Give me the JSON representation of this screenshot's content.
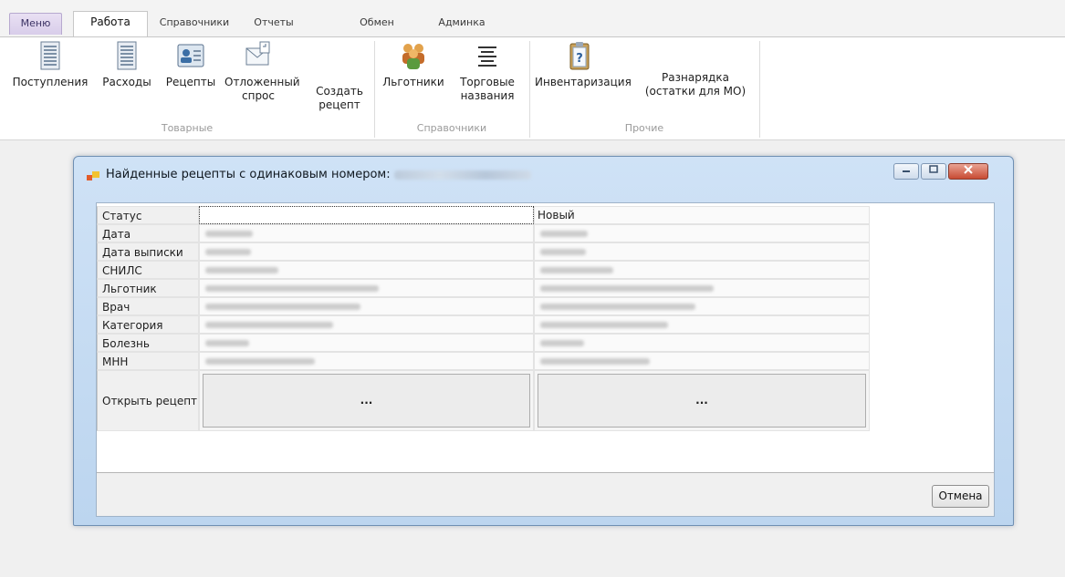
{
  "tabs": {
    "menu": "Меню",
    "work": "Работа",
    "directories": "Справочники",
    "reports": "Отчеты",
    "exchange": "Обмен",
    "admin": "Админка"
  },
  "ribbon": {
    "buttons": {
      "receipts": "Поступления",
      "expenses": "Расходы",
      "recipes": "Рецепты",
      "deferred_line1": "Отложенный",
      "deferred_line2": "спрос",
      "create_line1": "Создать",
      "create_line2": "рецепт",
      "beneficiaries": "Льготники",
      "trade_line1": "Торговые",
      "trade_line2": "названия",
      "inventory": "Инвентаризация",
      "allocation_line1": "Разнарядка",
      "allocation_line2": "(остатки для МО)"
    },
    "groups": {
      "goods": "Товарные",
      "directories": "Справочники",
      "other": "Прочие"
    }
  },
  "dialog": {
    "title": "Найденные рецепты с одинаковым номером:",
    "rows": {
      "status": "Статус",
      "date": "Дата",
      "issue_date": "Дата выписки",
      "snils": "СНИЛС",
      "beneficiary": "Льготник",
      "doctor": "Врач",
      "category": "Категория",
      "disease": "Болезнь",
      "inn": "МНН",
      "open": "Открыть рецепт"
    },
    "status_col2": "Новый",
    "open_button": "...",
    "cancel": "Отмена"
  },
  "icons": {
    "receipts": "document-icon",
    "expenses": "document-icon",
    "recipes": "id-card-icon",
    "deferred": "envelope-icon",
    "beneficiaries": "people-icon",
    "trade": "align-lines-icon",
    "inventory": "clipboard-question-icon",
    "dialog": "app-window-icon"
  }
}
